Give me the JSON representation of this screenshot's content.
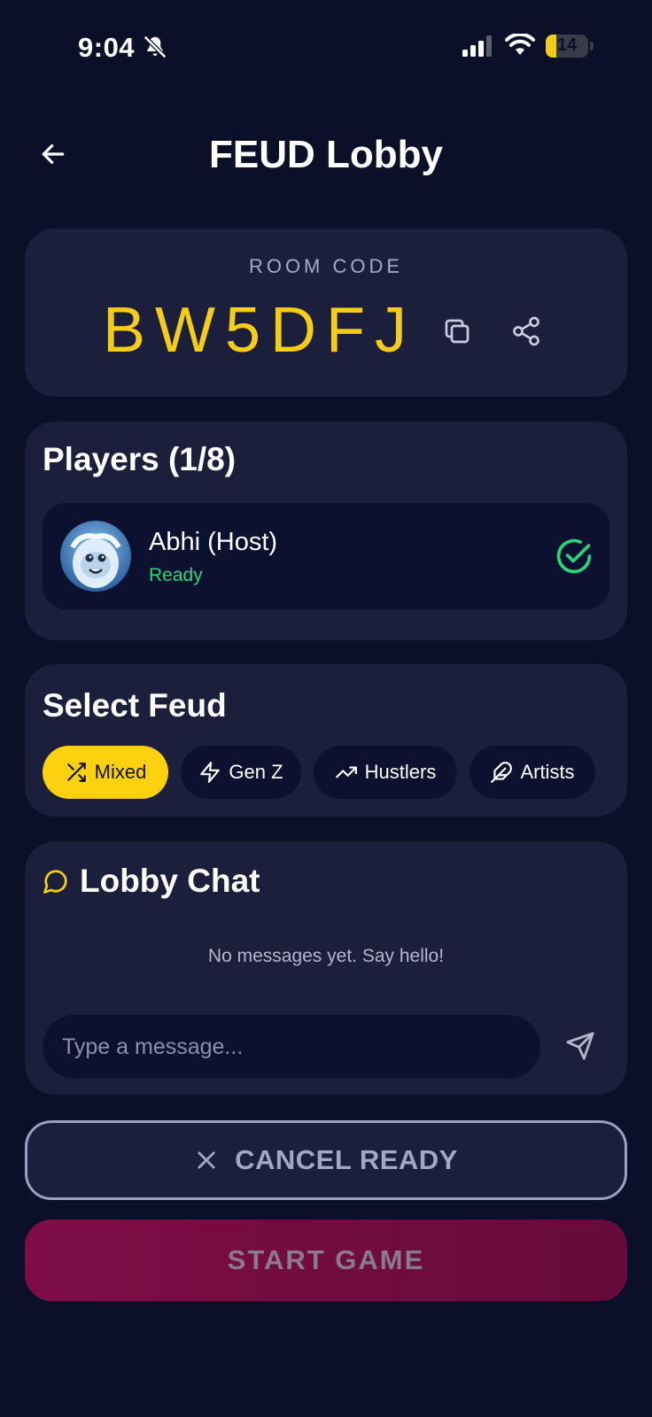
{
  "status_bar": {
    "time": "9:04",
    "battery": "14",
    "icons": [
      "bell-muted-icon",
      "signal-icon",
      "wifi-icon",
      "battery-icon"
    ]
  },
  "header": {
    "title": "FEUD Lobby",
    "back_icon": "arrow-left-icon"
  },
  "room": {
    "label": "ROOM CODE",
    "code": "BW5DFJ",
    "actions": [
      "copy-icon",
      "share-icon"
    ]
  },
  "players": {
    "title": "Players (1/8)",
    "list": [
      {
        "name": "Abhi (Host)",
        "status": "Ready",
        "avatar": "yeti-avatar"
      }
    ]
  },
  "select_feud": {
    "title": "Select Feud",
    "options": [
      {
        "label": "Mixed",
        "icon": "shuffle-icon",
        "selected": true
      },
      {
        "label": "Gen Z",
        "icon": "lightning-icon",
        "selected": false
      },
      {
        "label": "Hustlers",
        "icon": "trending-up-icon",
        "selected": false
      },
      {
        "label": "Artists",
        "icon": "feather-icon",
        "selected": false
      }
    ]
  },
  "chat": {
    "title": "Lobby Chat",
    "empty_text": "No messages yet. Say hello!",
    "input_placeholder": "Type a message...",
    "input_value": ""
  },
  "actions": {
    "cancel_ready": "CANCEL READY",
    "start_game": "START GAME"
  },
  "colors": {
    "background": "#0b0f28",
    "card": "#1b1f3c",
    "accent_yellow": "#fcd20e",
    "ready_green": "#2ad67a",
    "start_button": "#7e0d47"
  }
}
